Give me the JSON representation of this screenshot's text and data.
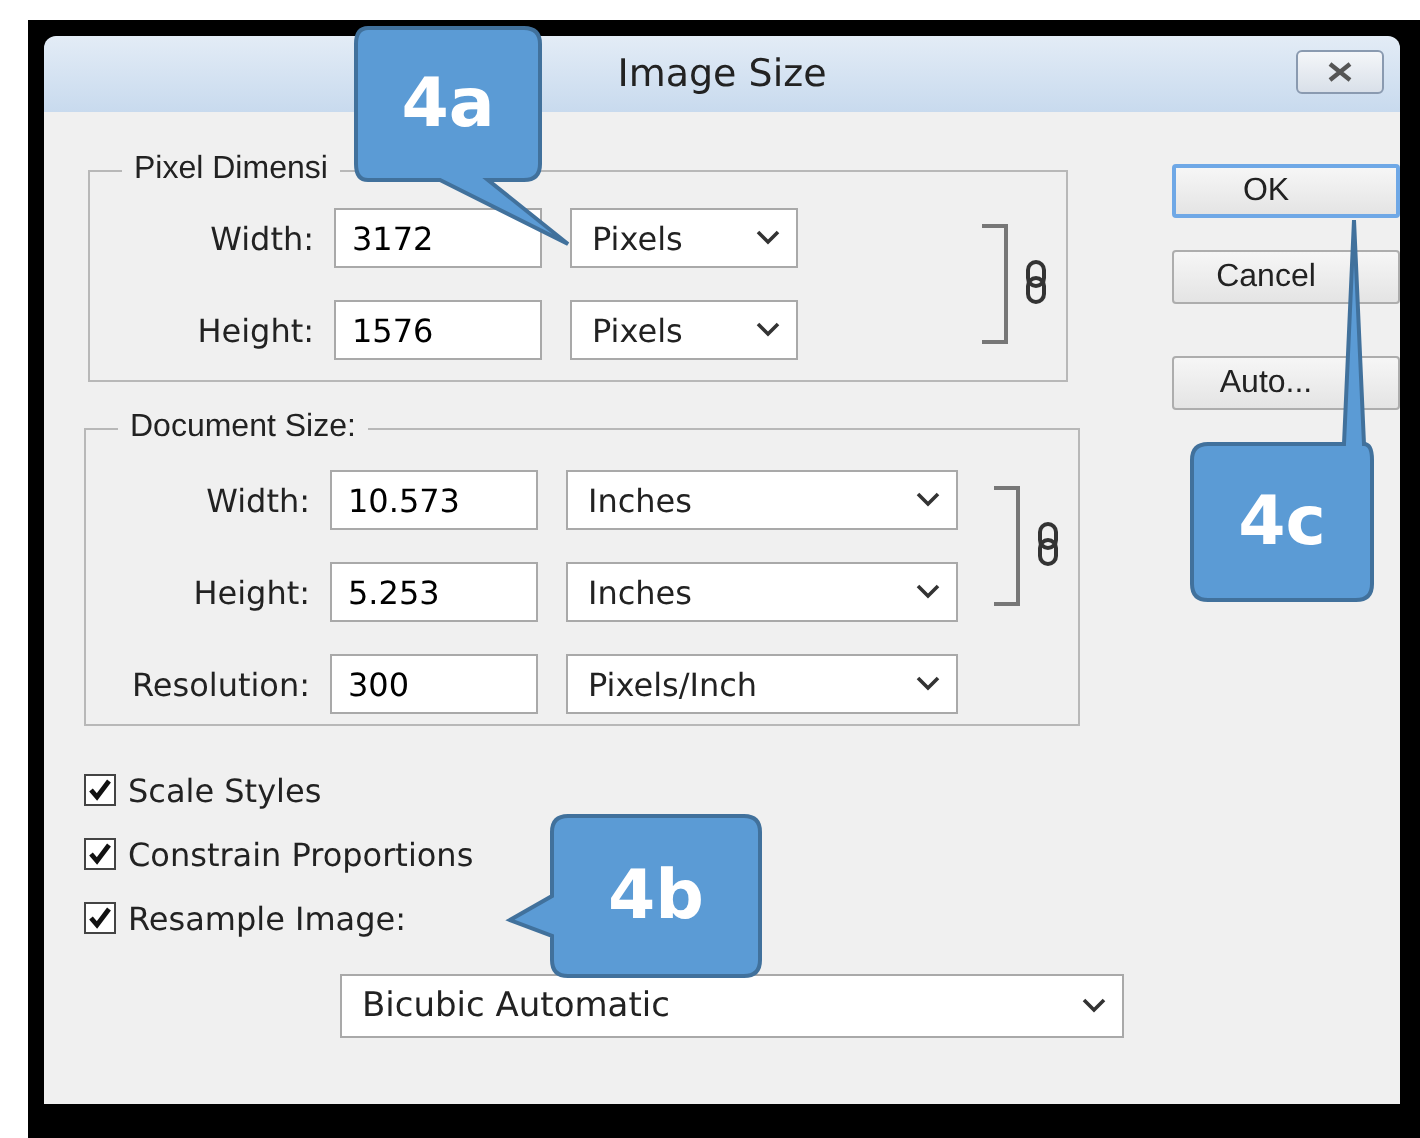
{
  "window": {
    "title": "Image Size"
  },
  "pixel_dimensions": {
    "legend": "Pixel Dimensi",
    "rows": [
      {
        "label": "Width:",
        "value": "3172",
        "unit": "Pixels"
      },
      {
        "label": "Height:",
        "value": "1576",
        "unit": "Pixels"
      }
    ]
  },
  "document_size": {
    "legend": "Document Size:",
    "rows": [
      {
        "label": "Width:",
        "value": "10.573",
        "unit": "Inches"
      },
      {
        "label": "Height:",
        "value": "5.253",
        "unit": "Inches"
      },
      {
        "label": "Resolution:",
        "value": "300",
        "unit": "Pixels/Inch"
      }
    ]
  },
  "buttons": [
    {
      "label": "OK",
      "default": true
    },
    {
      "label": "Cancel",
      "default": false
    },
    {
      "label": "Auto...",
      "default": false
    }
  ],
  "options": [
    {
      "label": "Scale Styles",
      "checked": true
    },
    {
      "label": "Constrain Proportions",
      "checked": true
    },
    {
      "label": "Resample Image:",
      "checked": true
    }
  ],
  "resample_method": "Bicubic Automatic",
  "callouts": [
    {
      "label": "4a"
    },
    {
      "label": "4b"
    },
    {
      "label": "4c"
    }
  ]
}
